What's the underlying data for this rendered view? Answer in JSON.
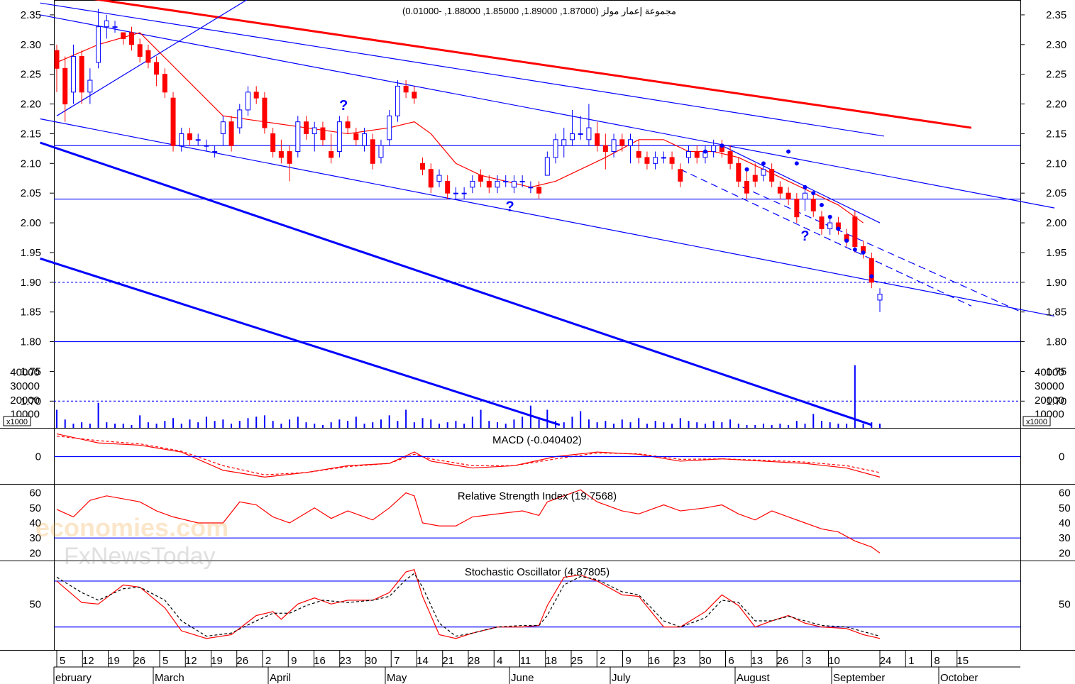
{
  "chart_data": {
    "type": "candlestick",
    "title": "مجموعة إعمار مولز (1.87000, 1.89000, 1.85000, 1.88000, -0.01000)",
    "last_bar": {
      "open": 1.87,
      "high": 1.89,
      "low": 1.85,
      "close": 1.88,
      "change": -0.01
    },
    "price_axis": {
      "ylim": [
        1.655,
        2.375
      ],
      "ticks": [
        "2.35",
        "2.30",
        "2.25",
        "2.20",
        "2.15",
        "2.10",
        "2.05",
        "2.00",
        "1.95",
        "1.90",
        "1.85",
        "1.80",
        "1.75",
        "1.70"
      ]
    },
    "volume_axis": {
      "ylim": [
        0,
        50000
      ],
      "ticks": [
        "40000",
        "30000",
        "20000",
        "10000"
      ],
      "unit": "x1000"
    },
    "x_axis": {
      "day_ticks": [
        "5",
        "12",
        "19",
        "26",
        "5",
        "12",
        "19",
        "26",
        "2",
        "9",
        "16",
        "23",
        "30",
        "7",
        "14",
        "21",
        "28",
        "4",
        "11",
        "18",
        "25",
        "2",
        "9",
        "16",
        "23",
        "30",
        "6",
        "13",
        "26",
        "3",
        "10",
        "24",
        "1",
        "8",
        "15"
      ],
      "months": [
        "ebruary",
        "March",
        "April",
        "May",
        "June",
        "July",
        "August",
        "September",
        "October"
      ]
    },
    "horizontal_levels": [
      {
        "value": 2.13,
        "style": "solid"
      },
      {
        "value": 2.04,
        "style": "solid"
      },
      {
        "value": 1.9,
        "style": "dashed"
      },
      {
        "value": 1.8,
        "style": "solid"
      },
      {
        "value": 1.7,
        "style": "dashed"
      }
    ],
    "ohlc": [
      {
        "x": 0,
        "o": 2.29,
        "h": 2.3,
        "l": 2.22,
        "c": 2.26
      },
      {
        "x": 2,
        "o": 2.26,
        "h": 2.28,
        "l": 2.17,
        "c": 2.2
      },
      {
        "x": 4,
        "o": 2.22,
        "h": 2.3,
        "l": 2.2,
        "c": 2.28
      },
      {
        "x": 6,
        "o": 2.28,
        "h": 2.29,
        "l": 2.2,
        "c": 2.22
      },
      {
        "x": 8,
        "o": 2.22,
        "h": 2.26,
        "l": 2.2,
        "c": 2.24
      },
      {
        "x": 10,
        "o": 2.27,
        "h": 2.36,
        "l": 2.26,
        "c": 2.33
      },
      {
        "x": 12,
        "o": 2.33,
        "h": 2.35,
        "l": 2.31,
        "c": 2.34
      },
      {
        "x": 14,
        "o": 2.33,
        "h": 2.34,
        "l": 2.32,
        "c": 2.33
      },
      {
        "x": 16,
        "o": 2.32,
        "h": 2.32,
        "l": 2.3,
        "c": 2.31
      },
      {
        "x": 18,
        "o": 2.32,
        "h": 2.33,
        "l": 2.29,
        "c": 2.3
      },
      {
        "x": 20,
        "o": 2.3,
        "h": 2.31,
        "l": 2.27,
        "c": 2.28
      },
      {
        "x": 22,
        "o": 2.29,
        "h": 2.3,
        "l": 2.26,
        "c": 2.27
      },
      {
        "x": 24,
        "o": 2.27,
        "h": 2.28,
        "l": 2.23,
        "c": 2.25
      },
      {
        "x": 26,
        "o": 2.25,
        "h": 2.26,
        "l": 2.21,
        "c": 2.22
      },
      {
        "x": 28,
        "o": 2.21,
        "h": 2.22,
        "l": 2.12,
        "c": 2.13
      },
      {
        "x": 30,
        "o": 2.13,
        "h": 2.16,
        "l": 2.12,
        "c": 2.15
      },
      {
        "x": 32,
        "o": 2.15,
        "h": 2.16,
        "l": 2.13,
        "c": 2.14
      },
      {
        "x": 34,
        "o": 2.14,
        "h": 2.15,
        "l": 2.13,
        "c": 2.14
      },
      {
        "x": 36,
        "o": 2.13,
        "h": 2.14,
        "l": 2.12,
        "c": 2.13
      },
      {
        "x": 38,
        "o": 2.12,
        "h": 2.13,
        "l": 2.11,
        "c": 2.12
      },
      {
        "x": 40,
        "o": 2.15,
        "h": 2.18,
        "l": 2.13,
        "c": 2.17
      },
      {
        "x": 42,
        "o": 2.17,
        "h": 2.18,
        "l": 2.12,
        "c": 2.13
      },
      {
        "x": 44,
        "o": 2.16,
        "h": 2.2,
        "l": 2.15,
        "c": 2.19
      },
      {
        "x": 46,
        "o": 2.19,
        "h": 2.23,
        "l": 2.18,
        "c": 2.22
      },
      {
        "x": 48,
        "o": 2.22,
        "h": 2.23,
        "l": 2.2,
        "c": 2.21
      },
      {
        "x": 50,
        "o": 2.21,
        "h": 2.22,
        "l": 2.15,
        "c": 2.16
      },
      {
        "x": 52,
        "o": 2.15,
        "h": 2.16,
        "l": 2.11,
        "c": 2.12
      },
      {
        "x": 54,
        "o": 2.12,
        "h": 2.14,
        "l": 2.1,
        "c": 2.11
      },
      {
        "x": 56,
        "o": 2.12,
        "h": 2.13,
        "l": 2.07,
        "c": 2.1
      },
      {
        "x": 58,
        "o": 2.12,
        "h": 2.18,
        "l": 2.11,
        "c": 2.17
      },
      {
        "x": 60,
        "o": 2.17,
        "h": 2.18,
        "l": 2.14,
        "c": 2.15
      },
      {
        "x": 62,
        "o": 2.15,
        "h": 2.17,
        "l": 2.12,
        "c": 2.16
      },
      {
        "x": 64,
        "o": 2.16,
        "h": 2.17,
        "l": 2.13,
        "c": 2.14
      },
      {
        "x": 66,
        "o": 2.12,
        "h": 2.15,
        "l": 2.1,
        "c": 2.11
      },
      {
        "x": 68,
        "o": 2.12,
        "h": 2.18,
        "l": 2.11,
        "c": 2.17
      },
      {
        "x": 70,
        "o": 2.17,
        "h": 2.18,
        "l": 2.15,
        "c": 2.16
      },
      {
        "x": 72,
        "o": 2.15,
        "h": 2.16,
        "l": 2.13,
        "c": 2.14
      },
      {
        "x": 74,
        "o": 2.13,
        "h": 2.16,
        "l": 2.12,
        "c": 2.15
      },
      {
        "x": 76,
        "o": 2.14,
        "h": 2.15,
        "l": 2.09,
        "c": 2.1
      },
      {
        "x": 78,
        "o": 2.11,
        "h": 2.14,
        "l": 2.1,
        "c": 2.13
      },
      {
        "x": 80,
        "o": 2.14,
        "h": 2.19,
        "l": 2.13,
        "c": 2.18
      },
      {
        "x": 82,
        "o": 2.18,
        "h": 2.24,
        "l": 2.17,
        "c": 2.23
      },
      {
        "x": 84,
        "o": 2.23,
        "h": 2.24,
        "l": 2.21,
        "c": 2.22
      },
      {
        "x": 86,
        "o": 2.22,
        "h": 2.23,
        "l": 2.2,
        "c": 2.21
      },
      {
        "x": 88,
        "o": 2.1,
        "h": 2.11,
        "l": 2.08,
        "c": 2.09
      },
      {
        "x": 90,
        "o": 2.09,
        "h": 2.1,
        "l": 2.05,
        "c": 2.06
      },
      {
        "x": 92,
        "o": 2.07,
        "h": 2.09,
        "l": 2.06,
        "c": 2.08
      },
      {
        "x": 94,
        "o": 2.07,
        "h": 2.08,
        "l": 2.04,
        "c": 2.05
      },
      {
        "x": 96,
        "o": 2.05,
        "h": 2.06,
        "l": 2.04,
        "c": 2.05
      },
      {
        "x": 98,
        "o": 2.05,
        "h": 2.06,
        "l": 2.04,
        "c": 2.05
      },
      {
        "x": 100,
        "o": 2.06,
        "h": 2.08,
        "l": 2.05,
        "c": 2.07
      },
      {
        "x": 102,
        "o": 2.08,
        "h": 2.09,
        "l": 2.06,
        "c": 2.07
      },
      {
        "x": 104,
        "o": 2.07,
        "h": 2.08,
        "l": 2.05,
        "c": 2.06
      },
      {
        "x": 106,
        "o": 2.06,
        "h": 2.08,
        "l": 2.05,
        "c": 2.07
      },
      {
        "x": 108,
        "o": 2.07,
        "h": 2.08,
        "l": 2.06,
        "c": 2.07
      },
      {
        "x": 110,
        "o": 2.06,
        "h": 2.08,
        "l": 2.05,
        "c": 2.07
      },
      {
        "x": 112,
        "o": 2.07,
        "h": 2.08,
        "l": 2.06,
        "c": 2.07
      },
      {
        "x": 114,
        "o": 2.06,
        "h": 2.07,
        "l": 2.05,
        "c": 2.06
      },
      {
        "x": 116,
        "o": 2.06,
        "h": 2.07,
        "l": 2.04,
        "c": 2.05
      },
      {
        "x": 118,
        "o": 2.08,
        "h": 2.12,
        "l": 2.08,
        "c": 2.11
      },
      {
        "x": 120,
        "o": 2.11,
        "h": 2.15,
        "l": 2.1,
        "c": 2.14
      },
      {
        "x": 122,
        "o": 2.13,
        "h": 2.16,
        "l": 2.11,
        "c": 2.14
      },
      {
        "x": 124,
        "o": 2.14,
        "h": 2.19,
        "l": 2.13,
        "c": 2.15
      },
      {
        "x": 126,
        "o": 2.15,
        "h": 2.18,
        "l": 2.14,
        "c": 2.15
      },
      {
        "x": 128,
        "o": 2.14,
        "h": 2.2,
        "l": 2.13,
        "c": 2.16
      },
      {
        "x": 130,
        "o": 2.15,
        "h": 2.17,
        "l": 2.12,
        "c": 2.13
      },
      {
        "x": 132,
        "o": 2.13,
        "h": 2.15,
        "l": 2.09,
        "c": 2.12
      },
      {
        "x": 134,
        "o": 2.12,
        "h": 2.15,
        "l": 2.11,
        "c": 2.14
      },
      {
        "x": 136,
        "o": 2.14,
        "h": 2.15,
        "l": 2.12,
        "c": 2.13
      },
      {
        "x": 138,
        "o": 2.13,
        "h": 2.15,
        "l": 2.1,
        "c": 2.14
      },
      {
        "x": 140,
        "o": 2.12,
        "h": 2.14,
        "l": 2.1,
        "c": 2.11
      },
      {
        "x": 142,
        "o": 2.11,
        "h": 2.12,
        "l": 2.09,
        "c": 2.1
      },
      {
        "x": 144,
        "o": 2.1,
        "h": 2.12,
        "l": 2.09,
        "c": 2.11
      },
      {
        "x": 146,
        "o": 2.11,
        "h": 2.12,
        "l": 2.1,
        "c": 2.11
      },
      {
        "x": 148,
        "o": 2.11,
        "h": 2.12,
        "l": 2.09,
        "c": 2.1
      },
      {
        "x": 150,
        "o": 2.09,
        "h": 2.1,
        "l": 2.06,
        "c": 2.07
      },
      {
        "x": 152,
        "o": 2.11,
        "h": 2.13,
        "l": 2.1,
        "c": 2.12
      },
      {
        "x": 154,
        "o": 2.12,
        "h": 2.13,
        "l": 2.1,
        "c": 2.11
      },
      {
        "x": 156,
        "o": 2.11,
        "h": 2.13,
        "l": 2.1,
        "c": 2.12
      },
      {
        "x": 158,
        "o": 2.12,
        "h": 2.14,
        "l": 2.11,
        "c": 2.13
      },
      {
        "x": 160,
        "o": 2.13,
        "h": 2.14,
        "l": 2.11,
        "c": 2.12
      },
      {
        "x": 162,
        "o": 2.12,
        "h": 2.13,
        "l": 2.09,
        "c": 2.1
      },
      {
        "x": 164,
        "o": 2.1,
        "h": 2.11,
        "l": 2.06,
        "c": 2.07
      },
      {
        "x": 166,
        "o": 2.07,
        "h": 2.09,
        "l": 2.04,
        "c": 2.05
      },
      {
        "x": 168,
        "o": 2.08,
        "h": 2.1,
        "l": 2.06,
        "c": 2.07
      },
      {
        "x": 170,
        "o": 2.08,
        "h": 2.1,
        "l": 2.07,
        "c": 2.09
      },
      {
        "x": 172,
        "o": 2.09,
        "h": 2.1,
        "l": 2.06,
        "c": 2.07
      },
      {
        "x": 174,
        "o": 2.06,
        "h": 2.07,
        "l": 2.04,
        "c": 2.05
      },
      {
        "x": 176,
        "o": 2.05,
        "h": 2.06,
        "l": 2.03,
        "c": 2.04
      },
      {
        "x": 178,
        "o": 2.04,
        "h": 2.05,
        "l": 2.0,
        "c": 2.01
      },
      {
        "x": 180,
        "o": 2.04,
        "h": 2.06,
        "l": 2.02,
        "c": 2.05
      },
      {
        "x": 182,
        "o": 2.04,
        "h": 2.05,
        "l": 2.01,
        "c": 2.02
      },
      {
        "x": 184,
        "o": 2.01,
        "h": 2.02,
        "l": 1.98,
        "c": 1.99
      },
      {
        "x": 186,
        "o": 1.99,
        "h": 2.01,
        "l": 1.98,
        "c": 2.0
      },
      {
        "x": 188,
        "o": 2.0,
        "h": 2.01,
        "l": 1.98,
        "c": 1.99
      },
      {
        "x": 190,
        "o": 1.98,
        "h": 1.99,
        "l": 1.96,
        "c": 1.97
      },
      {
        "x": 192,
        "o": 2.01,
        "h": 2.02,
        "l": 1.95,
        "c": 1.96
      },
      {
        "x": 194,
        "o": 1.96,
        "h": 1.97,
        "l": 1.94,
        "c": 1.95
      },
      {
        "x": 196,
        "o": 1.94,
        "h": 1.95,
        "l": 1.89,
        "c": 1.9
      },
      {
        "x": 198,
        "o": 1.87,
        "h": 1.89,
        "l": 1.85,
        "c": 1.88
      }
    ],
    "moving_average": [
      [
        0,
        2.27
      ],
      [
        10,
        2.3
      ],
      [
        20,
        2.32
      ],
      [
        30,
        2.25
      ],
      [
        40,
        2.18
      ],
      [
        50,
        2.17
      ],
      [
        60,
        2.16
      ],
      [
        70,
        2.15
      ],
      [
        80,
        2.16
      ],
      [
        86,
        2.17
      ],
      [
        90,
        2.15
      ],
      [
        96,
        2.1
      ],
      [
        102,
        2.08
      ],
      [
        108,
        2.07
      ],
      [
        114,
        2.06
      ],
      [
        120,
        2.07
      ],
      [
        126,
        2.09
      ],
      [
        132,
        2.11
      ],
      [
        140,
        2.14
      ],
      [
        146,
        2.14
      ],
      [
        152,
        2.12
      ],
      [
        158,
        2.12
      ],
      [
        164,
        2.11
      ],
      [
        170,
        2.09
      ],
      [
        176,
        2.07
      ],
      [
        182,
        2.05
      ],
      [
        188,
        2.03
      ],
      [
        194,
        2.0
      ]
    ],
    "volume": [
      [
        0,
        13000
      ],
      [
        2,
        6000
      ],
      [
        4,
        3000
      ],
      [
        6,
        4000
      ],
      [
        8,
        3000
      ],
      [
        10,
        18000
      ],
      [
        12,
        4000
      ],
      [
        14,
        3000
      ],
      [
        16,
        3000
      ],
      [
        18,
        2000
      ],
      [
        20,
        9000
      ],
      [
        22,
        4000
      ],
      [
        24,
        3000
      ],
      [
        26,
        5000
      ],
      [
        28,
        7000
      ],
      [
        30,
        3000
      ],
      [
        32,
        6000
      ],
      [
        34,
        4000
      ],
      [
        36,
        8000
      ],
      [
        38,
        5000
      ],
      [
        40,
        6000
      ],
      [
        42,
        3000
      ],
      [
        44,
        5000
      ],
      [
        46,
        7000
      ],
      [
        48,
        8000
      ],
      [
        50,
        9000
      ],
      [
        52,
        5000
      ],
      [
        54,
        3000
      ],
      [
        56,
        6000
      ],
      [
        58,
        8000
      ],
      [
        60,
        4000
      ],
      [
        62,
        3000
      ],
      [
        64,
        2000
      ],
      [
        66,
        4000
      ],
      [
        68,
        6000
      ],
      [
        70,
        5000
      ],
      [
        72,
        8000
      ],
      [
        74,
        3000
      ],
      [
        76,
        4000
      ],
      [
        78,
        6000
      ],
      [
        80,
        9000
      ],
      [
        82,
        5000
      ],
      [
        84,
        13000
      ],
      [
        86,
        4000
      ],
      [
        88,
        7000
      ],
      [
        90,
        6000
      ],
      [
        92,
        3000
      ],
      [
        94,
        4000
      ],
      [
        96,
        5000
      ],
      [
        98,
        3000
      ],
      [
        100,
        8000
      ],
      [
        102,
        13000
      ],
      [
        104,
        5000
      ],
      [
        106,
        4000
      ],
      [
        108,
        3000
      ],
      [
        110,
        6000
      ],
      [
        112,
        8000
      ],
      [
        114,
        16000
      ],
      [
        116,
        6000
      ],
      [
        118,
        13000
      ],
      [
        120,
        5000
      ],
      [
        122,
        4000
      ],
      [
        124,
        8000
      ],
      [
        126,
        12000
      ],
      [
        128,
        6000
      ],
      [
        130,
        4000
      ],
      [
        132,
        5000
      ],
      [
        134,
        3000
      ],
      [
        136,
        6000
      ],
      [
        138,
        4000
      ],
      [
        140,
        7000
      ],
      [
        142,
        3000
      ],
      [
        144,
        5000
      ],
      [
        146,
        4000
      ],
      [
        148,
        3000
      ],
      [
        150,
        7000
      ],
      [
        152,
        5000
      ],
      [
        154,
        4000
      ],
      [
        156,
        3000
      ],
      [
        158,
        5000
      ],
      [
        160,
        4000
      ],
      [
        162,
        6000
      ],
      [
        164,
        3000
      ],
      [
        166,
        2000
      ],
      [
        168,
        2000
      ],
      [
        170,
        3000
      ],
      [
        172,
        2000
      ],
      [
        174,
        3000
      ],
      [
        176,
        2000
      ],
      [
        178,
        5000
      ],
      [
        180,
        3000
      ],
      [
        182,
        10000
      ],
      [
        184,
        5000
      ],
      [
        186,
        4000
      ],
      [
        188,
        3000
      ],
      [
        190,
        3000
      ],
      [
        192,
        45000
      ],
      [
        194,
        3000
      ],
      [
        196,
        4000
      ],
      [
        198,
        3000
      ]
    ],
    "macd": {
      "label": "MACD (-0.040402)",
      "value": -0.040402,
      "ticks": [
        "0"
      ],
      "ylim": [
        -0.06,
        0.06
      ]
    },
    "rsi": {
      "label": "Relative Strength Index (19.7568)",
      "value": 19.7568,
      "ticks": [
        "60",
        "50",
        "40",
        "30",
        "20"
      ],
      "ylim": [
        15,
        65
      ],
      "levels": [
        30
      ]
    },
    "stochastic": {
      "label": "Stochastic Oscillator (4.87805)",
      "value": 4.87805,
      "ticks": [
        "50"
      ],
      "ylim": [
        -10,
        105
      ],
      "levels": [
        80,
        20
      ]
    },
    "watermark": [
      "economies.com",
      "FxNewsToday"
    ]
  }
}
